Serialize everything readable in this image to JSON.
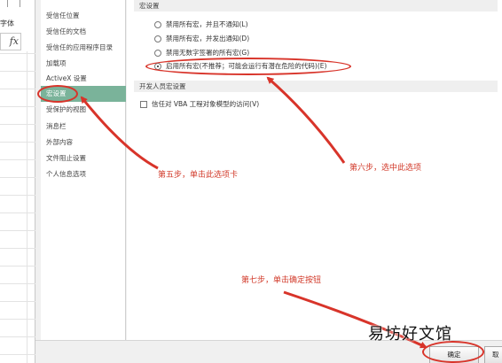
{
  "excel": {
    "font_label": "字体",
    "formula_fx": "fx"
  },
  "sidebar": {
    "items": [
      {
        "label": "受信任位置"
      },
      {
        "label": "受信任的文档"
      },
      {
        "label": "受信任的应用程序目录"
      },
      {
        "label": "加载项"
      },
      {
        "label": "ActiveX 设置"
      },
      {
        "label": "宏设置"
      },
      {
        "label": "受保护的视图"
      },
      {
        "label": "消息栏"
      },
      {
        "label": "外部内容"
      },
      {
        "label": "文件阻止设置"
      },
      {
        "label": "个人信息选项"
      }
    ],
    "active_index": 5
  },
  "content": {
    "macro_section_title": "宏设置",
    "macro_options": [
      {
        "label": "禁用所有宏，并且不通知(L)",
        "checked": false
      },
      {
        "label": "禁用所有宏，并发出通知(D)",
        "checked": false
      },
      {
        "label": "禁用无数字签署的所有宏(G)",
        "checked": false
      },
      {
        "label": "启用所有宏(不推荐；可能会运行有潜在危险的代码)(E)",
        "checked": true
      }
    ],
    "dev_section_title": "开发人员宏设置",
    "trust_vba_label": "信任对 VBA 工程对象模型的访问(V)",
    "trust_vba_checked": false
  },
  "footer": {
    "ok_label": "确定",
    "cancel_label": "取"
  },
  "annotations": {
    "step5": "第五步，单击此选项卡",
    "step6": "第六步，选中此选项",
    "step7": "第七步，单击确定按钮",
    "color": "#d23a2a"
  },
  "watermark": "易坊好文馆"
}
